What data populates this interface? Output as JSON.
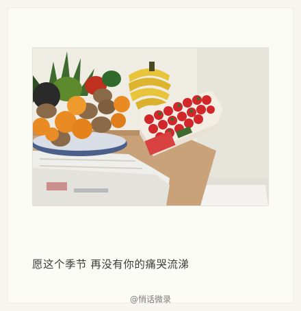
{
  "post": {
    "caption": "愿这个季节 再没有你的痛哭流涕",
    "watermark": "@悄话微录"
  },
  "photo": {
    "subject": "fruit bowl and crate of strawberries on a wooden table",
    "colors": {
      "wall": "#efece4",
      "table": "#c9a27a",
      "orange": "#e98a22",
      "kiwi": "#8a6a48",
      "banana": "#e8c43a",
      "strawberry": "#d2262b",
      "crate": "#f3ede4",
      "leaf": "#3f6b2e"
    }
  }
}
